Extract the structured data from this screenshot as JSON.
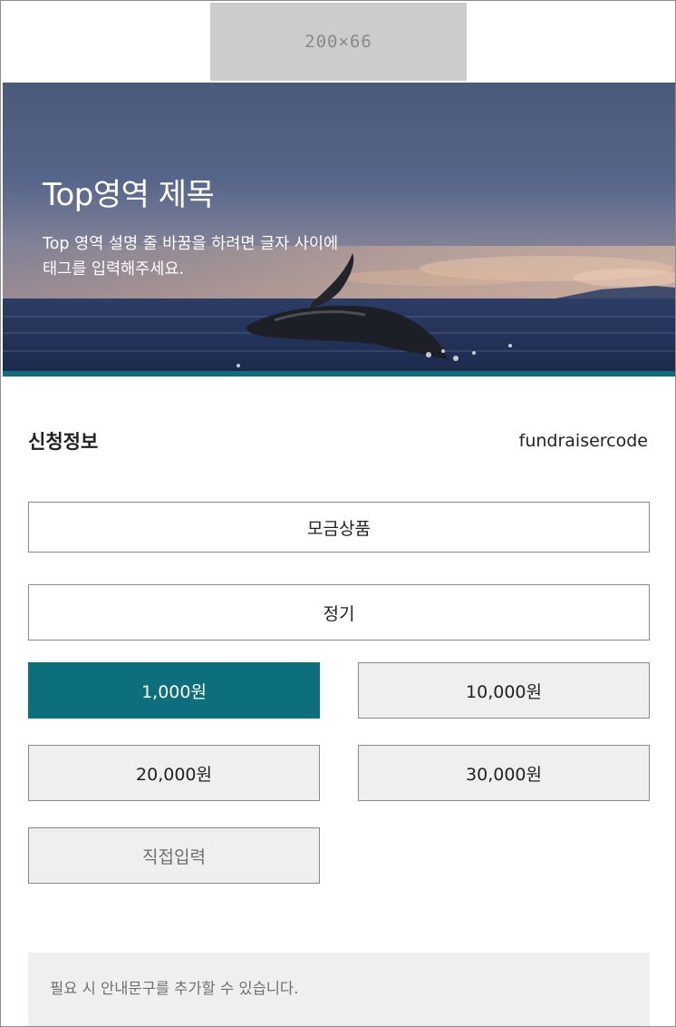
{
  "logo": {
    "placeholder": "200×66"
  },
  "hero": {
    "title": "Top영역 제목",
    "description_lines": [
      "Top 영역 설명 줄 바꿈을 하려면 글자 사이에",
      "태그를 입력해주세요."
    ]
  },
  "section": {
    "title": "신청정보",
    "code": "fundraisercode"
  },
  "product_button": {
    "label": "모금상품"
  },
  "period_button": {
    "label": "정기"
  },
  "amounts": [
    {
      "label": "1,000원",
      "selected": true
    },
    {
      "label": "10,000원",
      "selected": false
    },
    {
      "label": "20,000원",
      "selected": false
    },
    {
      "label": "30,000원",
      "selected": false
    }
  ],
  "custom_amount": {
    "label": "직접입력"
  },
  "notice": {
    "text": "필요 시 안내문구를 추가할 수 있습니다."
  },
  "colors": {
    "accent": "#0d6f7c",
    "button_bg": "#efefef",
    "border": "#8a8a8a"
  }
}
